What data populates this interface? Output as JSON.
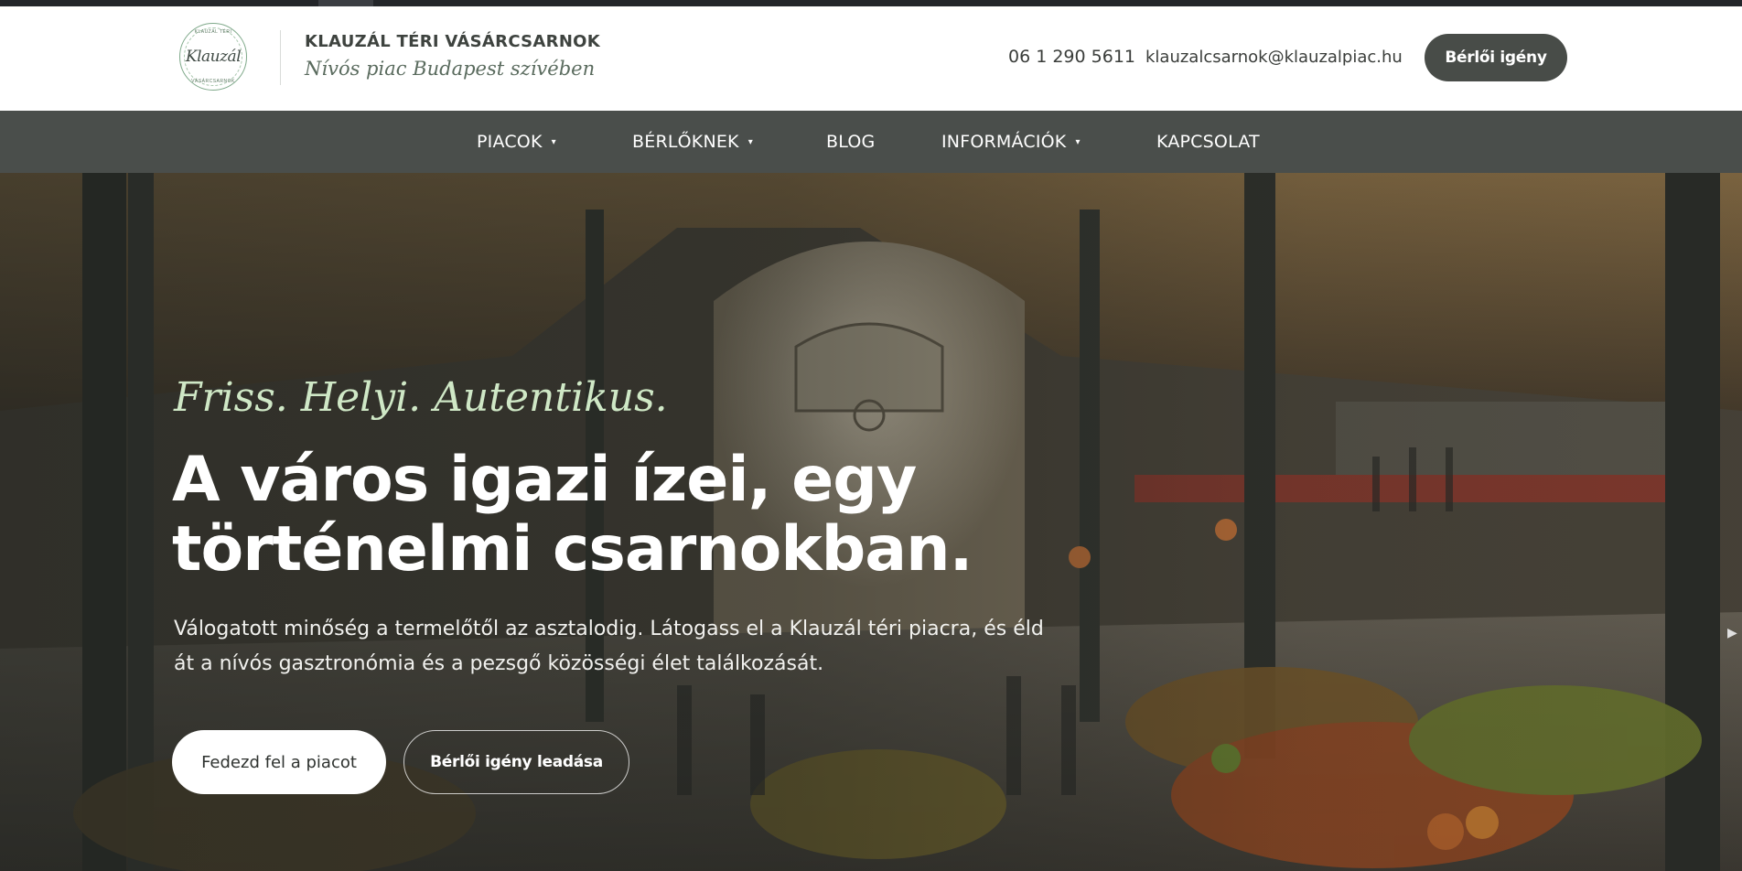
{
  "header": {
    "brand_name": "KLAUZÁL TÉRI VÁSÁRCSARNOK",
    "brand_tagline": "Nívós piac Budapest szívében",
    "logo_script": "Klauzál",
    "logo_arc_top": "KLAUZÁL TÉRI",
    "logo_arc_bottom": "VÁSÁRCSARNOK",
    "phone": "06 1 290 5611",
    "email": "klauzalcsarnok@klauzalpiac.hu",
    "cta_label": "Bérlői igény"
  },
  "nav": {
    "items": [
      {
        "label": "PIACOK",
        "has_dropdown": true
      },
      {
        "label": "BÉRLŐKNEK",
        "has_dropdown": true
      },
      {
        "label": "BLOG",
        "has_dropdown": false
      },
      {
        "label": "INFORMÁCIÓK",
        "has_dropdown": true
      },
      {
        "label": "KAPCSOLAT",
        "has_dropdown": false
      }
    ],
    "caret": "▾"
  },
  "hero": {
    "tagline": "Friss. Helyi. Autentikus.",
    "headline": "A város igazi ízei, egy történelmi csarnokban.",
    "lead": "Válogatott minőség a termelőtől az asztalodig. Látogass el a Klauzál téri piacra, és éld át a nívós gasztronómia és a pezsgő közösségi élet találkozását.",
    "primary_button": "Fedezd fel a piacot",
    "secondary_button": "Bérlői igény leadása",
    "slider_next": "▶"
  },
  "colors": {
    "nav_bg": "#4a4e4b",
    "header_button_bg": "#484c48",
    "tagline_green": "#cfe8c6",
    "top_strip": "#23262a"
  }
}
